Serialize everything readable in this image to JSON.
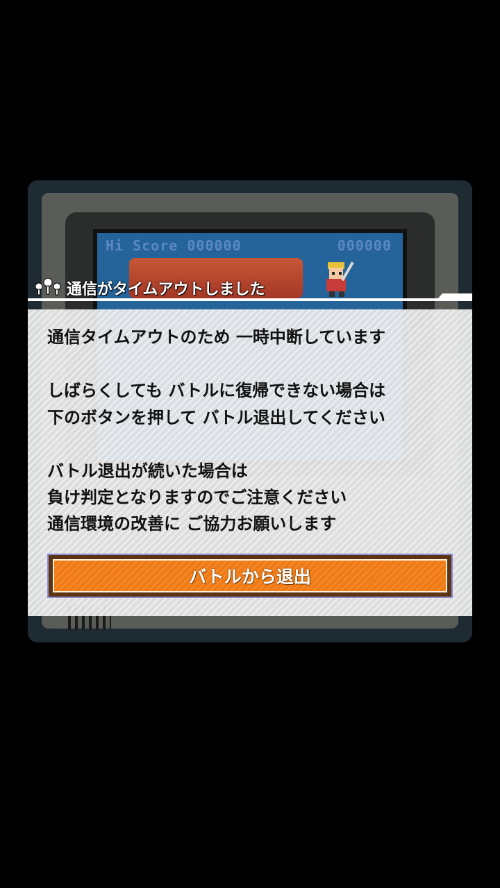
{
  "background_game": {
    "hi_score_label": "Hi Score 000000",
    "current_score": "000000"
  },
  "dialog": {
    "icon": "network-nodes-icon",
    "title": "通信がタイムアウトしました",
    "paragraph1": [
      "通信タイムアウトのため 一時中断しています"
    ],
    "paragraph2": [
      "しばらくしても バトルに復帰できない場合は",
      "下のボタンを押して バトル退出してください"
    ],
    "paragraph3": [
      "バトル退出が続いた場合は",
      "負け判定となりますのでご注意ください",
      "通信環境の改善に ご協力お願いします"
    ],
    "exit_button_label": "バトルから退出"
  },
  "colors": {
    "overlay_background": "#000000",
    "panel": "#e8e8e8",
    "button_orange": "#f07a13",
    "title_text": "#ffffff",
    "body_text": "#111111"
  }
}
